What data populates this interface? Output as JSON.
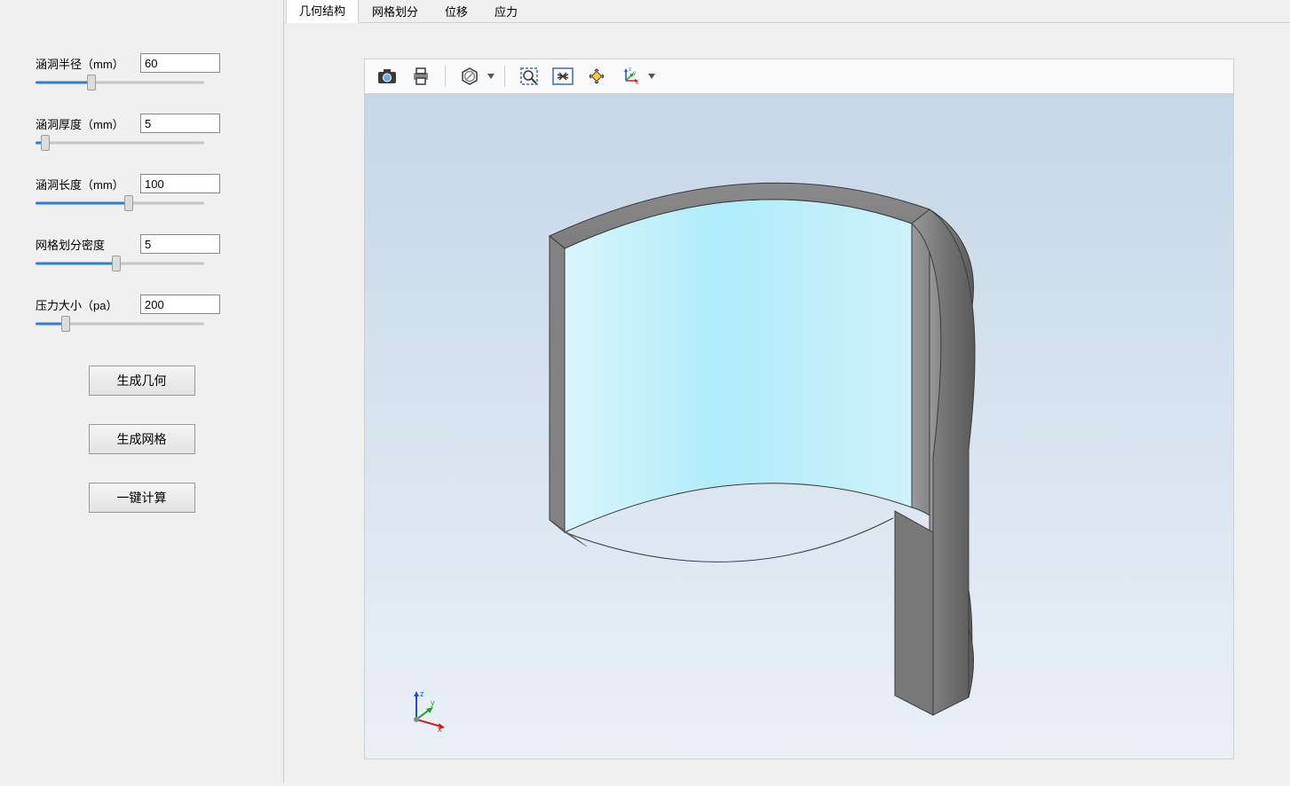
{
  "sidebar": {
    "params": [
      {
        "label": "涵洞半径（mm）",
        "value": "60",
        "fill_pct": 33
      },
      {
        "label": "涵洞厚度（mm）",
        "value": "5",
        "fill_pct": 6
      },
      {
        "label": "涵洞长度（mm）",
        "value": "100",
        "fill_pct": 55
      },
      {
        "label": "网格划分密度",
        "value": "5",
        "fill_pct": 48
      },
      {
        "label": "压力大小（pa）",
        "value": "200",
        "fill_pct": 18
      }
    ],
    "buttons": {
      "gen_geometry": "生成几何",
      "gen_mesh": "生成网格",
      "calculate": "一键计算"
    }
  },
  "tabs": [
    {
      "label": "几何结构",
      "active": true
    },
    {
      "label": "网格划分",
      "active": false
    },
    {
      "label": "位移",
      "active": false
    },
    {
      "label": "应力",
      "active": false
    }
  ],
  "toolbar_icons": {
    "camera": "camera-icon",
    "print": "print-icon",
    "hide": "hide-icon",
    "zoom_window": "zoom-window-icon",
    "fit": "fit-icon",
    "rotate": "rotate-icon",
    "axes": "axes-icon"
  },
  "axis_labels": {
    "x": "x",
    "y": "y",
    "z": "z"
  }
}
